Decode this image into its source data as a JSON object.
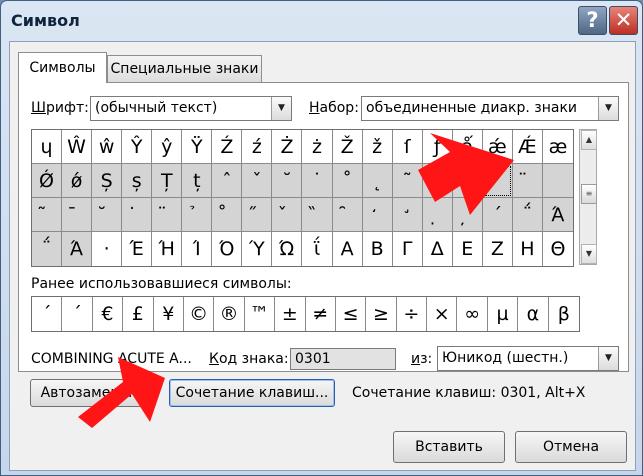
{
  "window": {
    "title": "Символ",
    "help_label": "?",
    "close_label": "✕"
  },
  "tabs": [
    {
      "label": "Символы",
      "active": true
    },
    {
      "label": "Специальные знаки",
      "active": false
    }
  ],
  "font": {
    "label_u": "Ш",
    "label_rest": "рифт:",
    "value": "(обычный текст)"
  },
  "subset": {
    "label_u": "Н",
    "label_rest": "абор:",
    "value": "объединенные диакр. знаки"
  },
  "symbol_grid": {
    "rows": [
      [
        "ɥ",
        "Ŵ",
        "ŵ",
        "Ŷ",
        "ŷ",
        "Ÿ",
        "Ź",
        "ź",
        "Ż",
        "ż",
        "Ž",
        "ž",
        "ſ",
        "ƒ",
        "ǻ",
        "ǽ",
        "Ǽ",
        "æ"
      ],
      [
        "Ǿ",
        "ǿ",
        "Ș",
        "ș",
        "Ț",
        "ț",
        "ˆ",
        "ˇ",
        "˘",
        "˙",
        "˚",
        "˛",
        "˜",
        "˝",
        "̀",
        "́",
        "̈",
        ""
      ],
      [
        "̃",
        "̄",
        "̆",
        "̇",
        "̈",
        "̉",
        "̊",
        "̋",
        "̌",
        "̏",
        "̑",
        "̒",
        "̛",
        "̣",
        "̦",
        "΄",
        "΅",
        "Ά"
      ],
      [
        "΅",
        "Ά",
        "·",
        "Έ",
        "Ή",
        "Ί",
        "Ό",
        "Ύ",
        "Ώ",
        "ΐ",
        "Α",
        "Β",
        "Γ",
        "Δ",
        "Ε",
        "Ζ",
        "Η",
        "Θ"
      ]
    ],
    "selected": "́"
  },
  "recent": {
    "label": "Ранее использовавшиеся символы:",
    "items": [
      "΄",
      "΄",
      "€",
      "£",
      "¥",
      "©",
      "®",
      "™",
      "±",
      "≠",
      "≤",
      "≥",
      "÷",
      "×",
      "∞",
      "µ",
      "α",
      "β"
    ]
  },
  "char_name": "COMBINING ACUTE A...",
  "code": {
    "label_u": "К",
    "label_rest": "од знака:",
    "value": "0301"
  },
  "from": {
    "label_u": "и",
    "label_rest": "з:",
    "value": "Юникод (шестн.)"
  },
  "autocorrect_label": "Автозамена...",
  "shortcut_button_label": "Сочетание клавиш...",
  "shortcut_text": "Сочетание клавиш: 0301, Alt+X",
  "insert_label": "Вставить",
  "cancel_label": "Отмена",
  "colors": {
    "arrow": "#ff1515",
    "close": "#c9372b"
  }
}
